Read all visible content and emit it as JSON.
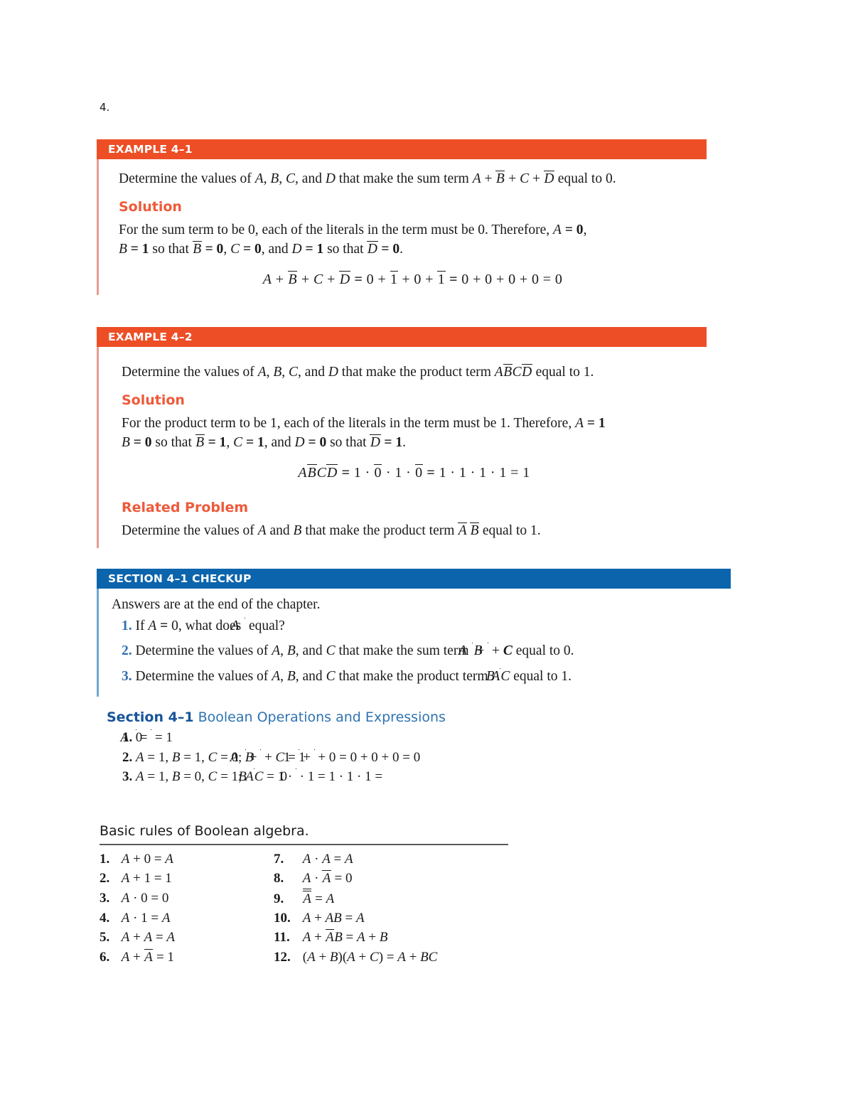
{
  "page": {
    "question_number": "4.",
    "colors": {
      "example_bar": "#ED4E26",
      "section_bar": "#0B64AC",
      "solution_heading": "#EE5A3A",
      "checkup_number": "#2D6FAE",
      "answers_heading": "#2E73B0"
    }
  },
  "example1": {
    "bar_label": "EXAMPLE 4–1",
    "problem_pre": "Determine the values of ",
    "problem_vars": "A, B, C,",
    "problem_mid": " and ",
    "problem_var_d": "D",
    "problem_post": " that make the sum term ",
    "problem_term": "A + B̄ + C + D̄",
    "problem_end": " equal to 0.",
    "solution_heading": "Solution",
    "solution_line1": "For the sum term to be 0, each of the literals in the term must be 0. Therefore, A = 0,",
    "solution_line2": "B = 1 so that B̄ = 0, C = 0, and D = 1 so that D̄ = 0.",
    "equation": "A + B̄ + C + D̄ = 0 + 1̄ + 0 + 1̄ = 0 + 0 + 0 + 0 = 0"
  },
  "example2": {
    "bar_label": "EXAMPLE 4–2",
    "problem": "Determine the values of A, B, C, and D that make the product term AB̄CD̄ equal to 1.",
    "solution_heading": "Solution",
    "solution_line1": "For the product term to be 1, each of the literals in the term must be 1. Therefore, A = 1",
    "solution_line2": "B = 0 so that B̄ = 1, C = 1, and D = 0 so that D̄ = 1.",
    "equation": "AB̄CD̄ = 1 · 0̄ · 1 · 0̄ = 1 · 1 · 1 · 1 = 1",
    "related_heading": "Related Problem",
    "related_text": "Determine the values of A and B that make the product term Ā B̄ equal to 1."
  },
  "checkup": {
    "bar_label": "SECTION 4–1  CHECKUP",
    "intro": "Answers are at the end of the chapter.",
    "items": [
      {
        "num": "1.",
        "text": "If A = 0, what does Ā equal?"
      },
      {
        "num": "2.",
        "text": "Determine the values of A, B, and C that make the sum term Ā + B̄ + C equal to 0."
      },
      {
        "num": "3.",
        "text": "Determine the values of A, B, and C that make the product term AB̄C equal to 1."
      }
    ]
  },
  "answers": {
    "heading_bold": "Section 4–1",
    "heading_rest": " Boolean Operations and Expressions",
    "items": [
      {
        "num": "1.",
        "text": "Ā = 0̄ = 1"
      },
      {
        "num": "2.",
        "text": "A = 1, B = 1, C = 0; Ā + B̄ + C = 1̄ + 1̄ + 0 = 0 + 0 + 0 = 0"
      },
      {
        "num": "3.",
        "text": "A = 1, B = 0, C = 1; AB̄C = 1 · 0̄ · 1 = 1 · 1 · 1 ="
      }
    ]
  },
  "rules": {
    "title": "Basic rules of Boolean algebra.",
    "column1": [
      {
        "num": "1.",
        "text": "A + 0 = A"
      },
      {
        "num": "2.",
        "text": "A + 1 = 1"
      },
      {
        "num": "3.",
        "text": "A · 0 = 0"
      },
      {
        "num": "4.",
        "text": "A · 1 = A"
      },
      {
        "num": "5.",
        "text": "A + A = A"
      },
      {
        "num": "6.",
        "text": "A + Ā = 1"
      }
    ],
    "column2": [
      {
        "num": "7.",
        "text": "A · A = A"
      },
      {
        "num": "8.",
        "text": "A · Ā = 0"
      },
      {
        "num": "9.",
        "text": "Ā̄ = A"
      },
      {
        "num": "10.",
        "text": "A + AB = A"
      },
      {
        "num": "11.",
        "text": "A + ĀB = A + B"
      },
      {
        "num": "12.",
        "text": "(A + B)(A + C) = A + BC"
      }
    ]
  }
}
